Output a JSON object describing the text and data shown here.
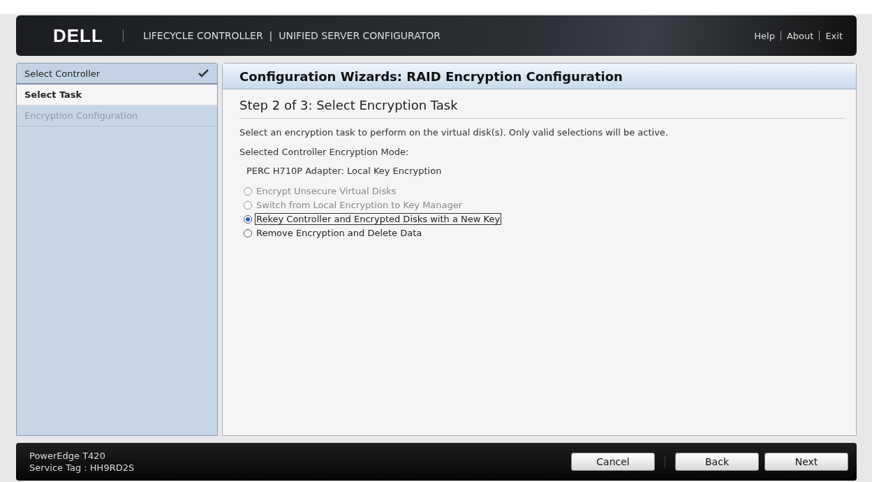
{
  "header": {
    "logo": "DELL",
    "title": "LIFECYCLE CONTROLLER  |  UNIFIED SERVER CONFIGURATOR",
    "links": [
      "Help",
      "About",
      "Exit"
    ]
  },
  "sidebar": {
    "items": [
      {
        "label": "Select Controller",
        "selected": false,
        "completed": true,
        "disabled": false
      },
      {
        "label": "Select Task",
        "selected": true,
        "completed": false,
        "disabled": false
      },
      {
        "label": "Encryption Configuration",
        "selected": false,
        "completed": false,
        "disabled": true
      }
    ]
  },
  "main": {
    "title": "Configuration Wizards: RAID Encryption Configuration",
    "step": "Step 2 of 3: Select Encryption Task",
    "description": "Select an encryption task to perform on the virtual disk(s). Only valid selections will be active.",
    "mode_label": "Selected Controller Encryption Mode:",
    "mode_value": "PERC H710P Adapter: Local Key Encryption",
    "options": [
      {
        "label": "Encrypt Unsecure Virtual Disks",
        "selected": false,
        "disabled": true,
        "focused": false
      },
      {
        "label": "Switch from Local Encryption to Key Manager",
        "selected": false,
        "disabled": true,
        "focused": false
      },
      {
        "label": "Rekey Controller and Encrypted Disks with a New Key",
        "selected": true,
        "disabled": false,
        "focused": true
      },
      {
        "label": "Remove Encryption and Delete Data",
        "selected": false,
        "disabled": false,
        "focused": false
      }
    ]
  },
  "footer": {
    "model": "PowerEdge T420",
    "service_tag": "Service Tag : HH9RD2S",
    "buttons": [
      "Cancel",
      "Back",
      "Next"
    ]
  }
}
